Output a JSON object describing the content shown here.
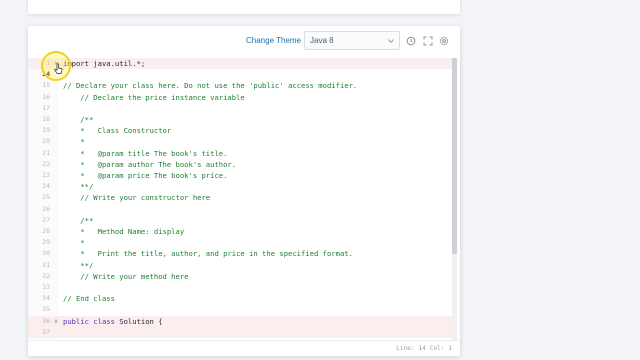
{
  "toolbar": {
    "change_theme_label": "Change Theme",
    "language_selected": "Java 8",
    "icons": [
      "history-icon",
      "fullscreen-icon",
      "settings-icon"
    ]
  },
  "editor": {
    "lines": [
      {
        "num": "1",
        "text": "import java.util.*;",
        "fold": "",
        "style": "plain",
        "highlight": true
      },
      {
        "num": "14",
        "text": "",
        "fold": "",
        "style": "plain",
        "highlight": false,
        "current": true
      },
      {
        "num": "15",
        "text": "// Declare your class here. Do not use the 'public' access modifier.",
        "fold": "",
        "style": "cmt"
      },
      {
        "num": "16",
        "text": "    // Declare the price instance variable",
        "fold": "",
        "style": "cmt"
      },
      {
        "num": "17",
        "text": "",
        "fold": "",
        "style": "cmt"
      },
      {
        "num": "18",
        "text": "    /**",
        "fold": "",
        "style": "cmt"
      },
      {
        "num": "19",
        "text": "    *   Class Constructor",
        "fold": "",
        "style": "cmt"
      },
      {
        "num": "20",
        "text": "    *",
        "fold": "",
        "style": "cmt"
      },
      {
        "num": "21",
        "text": "    *   @param title The book's title.",
        "fold": "",
        "style": "cmt"
      },
      {
        "num": "22",
        "text": "    *   @param author The book's author.",
        "fold": "",
        "style": "cmt"
      },
      {
        "num": "23",
        "text": "    *   @param price The book's price.",
        "fold": "",
        "style": "cmt"
      },
      {
        "num": "24",
        "text": "    **/",
        "fold": "",
        "style": "cmt"
      },
      {
        "num": "25",
        "text": "    // Write your constructor here",
        "fold": "",
        "style": "cmt"
      },
      {
        "num": "26",
        "text": "",
        "fold": "",
        "style": "cmt"
      },
      {
        "num": "27",
        "text": "    /**",
        "fold": "",
        "style": "cmt"
      },
      {
        "num": "28",
        "text": "    *   Method Name: display",
        "fold": "",
        "style": "cmt"
      },
      {
        "num": "29",
        "text": "    *",
        "fold": "",
        "style": "cmt"
      },
      {
        "num": "30",
        "text": "    *   Print the title, author, and price in the specified format.",
        "fold": "",
        "style": "cmt"
      },
      {
        "num": "31",
        "text": "    **/",
        "fold": "",
        "style": "cmt"
      },
      {
        "num": "32",
        "text": "    // Write your method here",
        "fold": "",
        "style": "cmt"
      },
      {
        "num": "33",
        "text": "",
        "fold": "",
        "style": "cmt"
      },
      {
        "num": "34",
        "text": "// End class",
        "fold": "",
        "style": "cmt"
      },
      {
        "num": "35",
        "text": "",
        "fold": "",
        "style": "plain"
      },
      {
        "num": "36",
        "kw": "public class",
        "text": " Solution {",
        "fold": "v",
        "style": "plain",
        "highlight": true
      },
      {
        "num": "37",
        "text": "",
        "fold": "",
        "style": "plain",
        "highlight": true
      }
    ],
    "fold_marker_line1": ">"
  },
  "status": {
    "text": "Line: 14 Col: 1"
  }
}
